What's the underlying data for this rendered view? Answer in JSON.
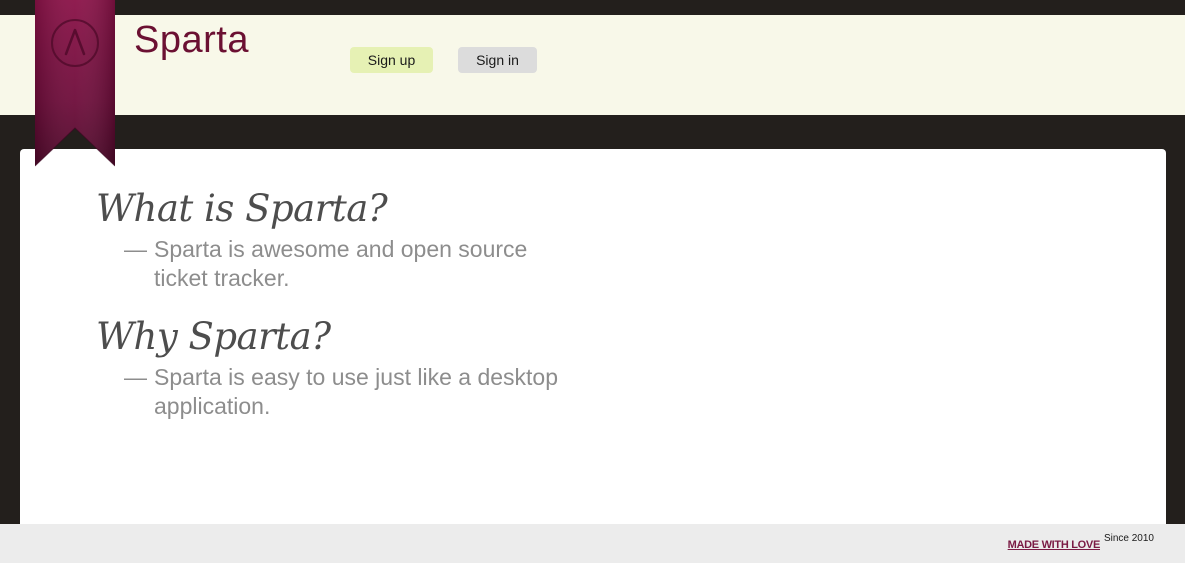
{
  "header": {
    "logo_text": "Sparta",
    "signup_label": "Sign up",
    "signin_label": "Sign in"
  },
  "main": {
    "sections": [
      {
        "heading": "What is Sparta?",
        "dash": "—",
        "text": "Sparta is awesome and open source ticket tracker."
      },
      {
        "heading": "Why Sparta?",
        "dash": "—",
        "text": "Sparta is easy to use just like a desktop application."
      }
    ]
  },
  "footer": {
    "made_with_love": "MADE WITH LOVE",
    "since": "Since 2010"
  },
  "colors": {
    "brand": "#6b1032",
    "header_bg": "#f8f8e9",
    "signup_bg": "#e6f1b4",
    "signin_bg": "#dcdcdc",
    "page_bg": "#231f1c"
  },
  "icons": {
    "logo": "caret-up-circle-icon"
  }
}
